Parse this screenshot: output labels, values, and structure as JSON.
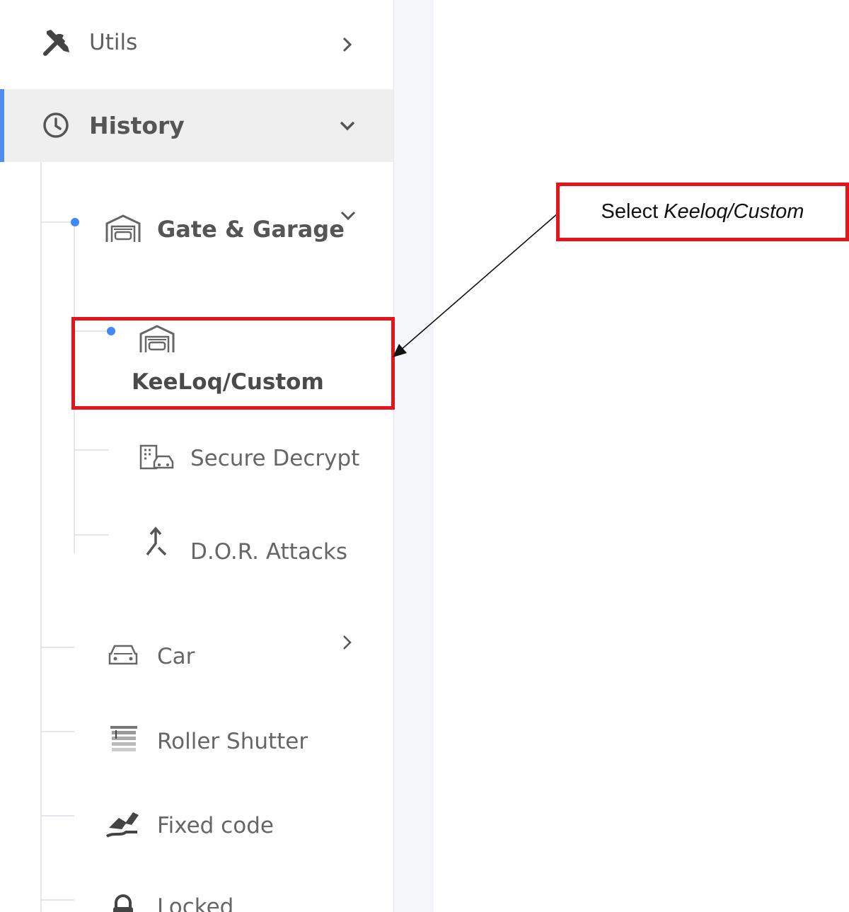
{
  "sidebar": {
    "utils": {
      "label": "Utils",
      "icon": "tools-icon"
    },
    "history": {
      "label": "History",
      "icon": "clock-icon"
    },
    "gate_garage": {
      "label": "Gate & Garage",
      "icon": "garage-icon"
    },
    "keeloq": {
      "label": "KeeLoq/Custom",
      "icon": "garage-icon"
    },
    "secure_decrypt": {
      "label": "Secure Decrypt",
      "icon": "building-car-icon"
    },
    "dor_attacks": {
      "label": "D.O.R. Attacks",
      "icon": "merge-arrow-icon"
    },
    "car": {
      "label": "Car",
      "icon": "car-icon"
    },
    "roller_shutter": {
      "label": "Roller Shutter",
      "icon": "shutter-icon"
    },
    "fixed_code": {
      "label": "Fixed code",
      "icon": "wave-icon"
    },
    "locked": {
      "label": "Locked",
      "icon": "lock-icon"
    }
  },
  "annotation": {
    "prefix": "Select",
    "target": "Keeloq/Custom"
  },
  "colors": {
    "accent": "#4d8ff0",
    "dot": "#3d8af5",
    "highlight_red": "#e5141b",
    "active_bg": "#efefef"
  }
}
